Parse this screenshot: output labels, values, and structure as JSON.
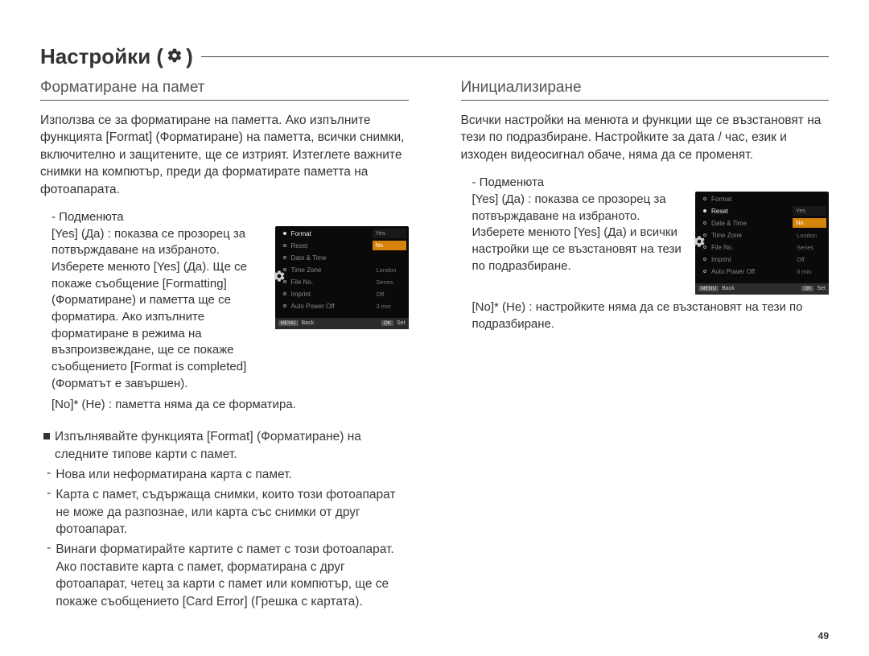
{
  "page_title_prefix": "Настройки (",
  "page_title_suffix": ")",
  "page_number": "49",
  "left": {
    "heading": "Форматиране на памет",
    "intro": "Използва се за форматиране на паметта. Ако изпълните функцията [Format] (Форматиране) на паметта, всички снимки, включително и защитените, ще се изтрият. Изтеглете важните снимки на компютър, преди да форматирате паметта на фотоапарата.",
    "submenus_label": "- Подменюта",
    "yes_label": "[Yes] (Да) :",
    "yes_text": "показва се прозорец за потвърждаване на избраното. Изберете менюто [Yes] (Да). Ще се покаже съобщение [Formatting] (Форматиране) и паметта ще се форматира. Ако изпълните форматиране в режима на възпроизвеждане, ще се покаже съобщението [Format is completed] (Форматът е завършен).",
    "no_label": "[No]* (Не) :",
    "no_text": "паметта няма да се форматира.",
    "bullet": "Изпълнявайте функцията [Format] (Форматиране) на следните типове карти с памет.",
    "dash1": "Нова или неформатирана карта с памет.",
    "dash2": "Карта с памет, съдържаща снимки, които този фотоапарат не може да разпознае, или карта със снимки от друг фотоапарат.",
    "dash3": "Винаги форматирайте картите с памет с този фотоапарат. Ако поставите карта с памет, форматирана с друг фотоапарат, четец за карти с памет или компютър, ще се покаже съобщението [Card Error] (Грешка с картата)."
  },
  "right": {
    "heading": "Инициализиране",
    "intro": "Всички настройки на менюта и функции ще се възстановят на тези по подразбиране. Настройките за дата / час, език и изходен видеосигнал обаче, няма да се променят.",
    "submenus_label": "- Подменюта",
    "yes_label": "[Yes] (Да) :",
    "yes_text": "показва се прозорец за потвърждаване на избраното. Изберете менюто [Yes] (Да) и всички настройки ще се възстановят на тези по подразбиране.",
    "no_label": "[No]* (Не) :",
    "no_text": "настройките няма да се възстановят на тези по подразбиране."
  },
  "lcd": {
    "items": [
      "Format",
      "Reset",
      "Date & Time",
      "Time Zone",
      "File No.",
      "Imprint",
      "Auto Power Off"
    ],
    "vals": [
      "",
      "",
      "",
      "London",
      "Series",
      "Off",
      "3 min"
    ],
    "yes": "Yes",
    "no": "No",
    "back_btn": "MENU",
    "back": "Back",
    "ok_btn": "OK",
    "set": "Set",
    "active_left": 0,
    "active_right": 1
  }
}
